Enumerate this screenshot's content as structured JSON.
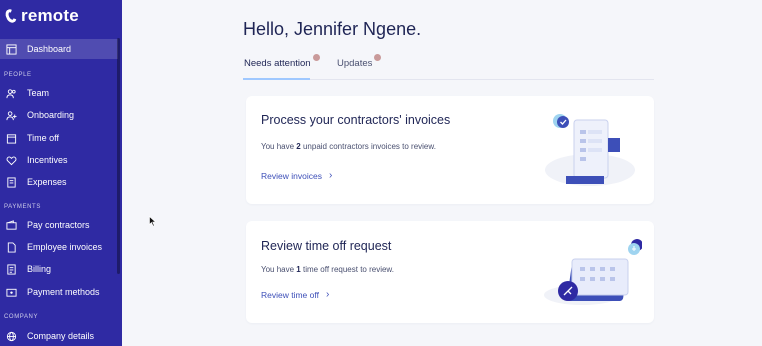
{
  "brand": {
    "name": "remote"
  },
  "sidebar": {
    "items": [
      {
        "label": "Dashboard",
        "icon": "layout-icon"
      },
      {
        "label": "Team",
        "icon": "users-icon"
      },
      {
        "label": "Onboarding",
        "icon": "user-plus-icon"
      },
      {
        "label": "Time off",
        "icon": "calendar-icon"
      },
      {
        "label": "Incentives",
        "icon": "heart-icon"
      },
      {
        "label": "Expenses",
        "icon": "receipt-icon"
      },
      {
        "label": "Pay contractors",
        "icon": "wallet-icon"
      },
      {
        "label": "Employee invoices",
        "icon": "document-icon"
      },
      {
        "label": "Billing",
        "icon": "bill-icon"
      },
      {
        "label": "Payment methods",
        "icon": "card-icon"
      },
      {
        "label": "Company details",
        "icon": "globe-icon"
      }
    ],
    "sections": {
      "people": "PEOPLE",
      "payments": "PAYMENTS",
      "company": "COMPANY"
    }
  },
  "main": {
    "greeting": "Hello, Jennifer Ngene.",
    "tabs": [
      {
        "label": "Needs attention"
      },
      {
        "label": "Updates"
      }
    ],
    "cards": [
      {
        "title": "Process your contractors' invoices",
        "desc_prefix": "You have ",
        "count": "2",
        "desc_suffix": " unpaid contractors invoices to review.",
        "link": "Review invoices"
      },
      {
        "title": "Review time off request",
        "desc_prefix": "You have ",
        "count": "1",
        "desc_suffix": " time off request to review.",
        "link": "Review time off"
      }
    ]
  },
  "colors": {
    "sidebar": "#2f2aa3",
    "accent": "#3d4fb8",
    "tab_dot": "#c99a9a",
    "text": "#1f2555"
  }
}
